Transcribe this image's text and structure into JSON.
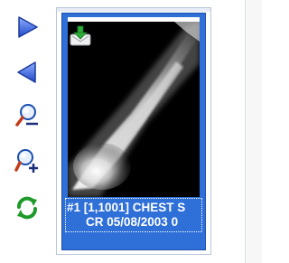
{
  "toolbar": {
    "buttons": [
      {
        "name": "next-icon",
        "color": "#2a55d6"
      },
      {
        "name": "previous-icon",
        "color": "#2a55d6"
      },
      {
        "name": "zoom-out-icon",
        "color": "#1a4fb0"
      },
      {
        "name": "zoom-in-icon",
        "color": "#1a4fb0"
      },
      {
        "name": "refresh-icon",
        "color": "#1e9a2a"
      }
    ]
  },
  "thumbnail": {
    "caption_line1": "#1 [1,1001] CHEST S",
    "caption_line2": "CR 05/08/2003 0",
    "selected_color": "#2e6fd8",
    "download_icon": "download-icon"
  }
}
